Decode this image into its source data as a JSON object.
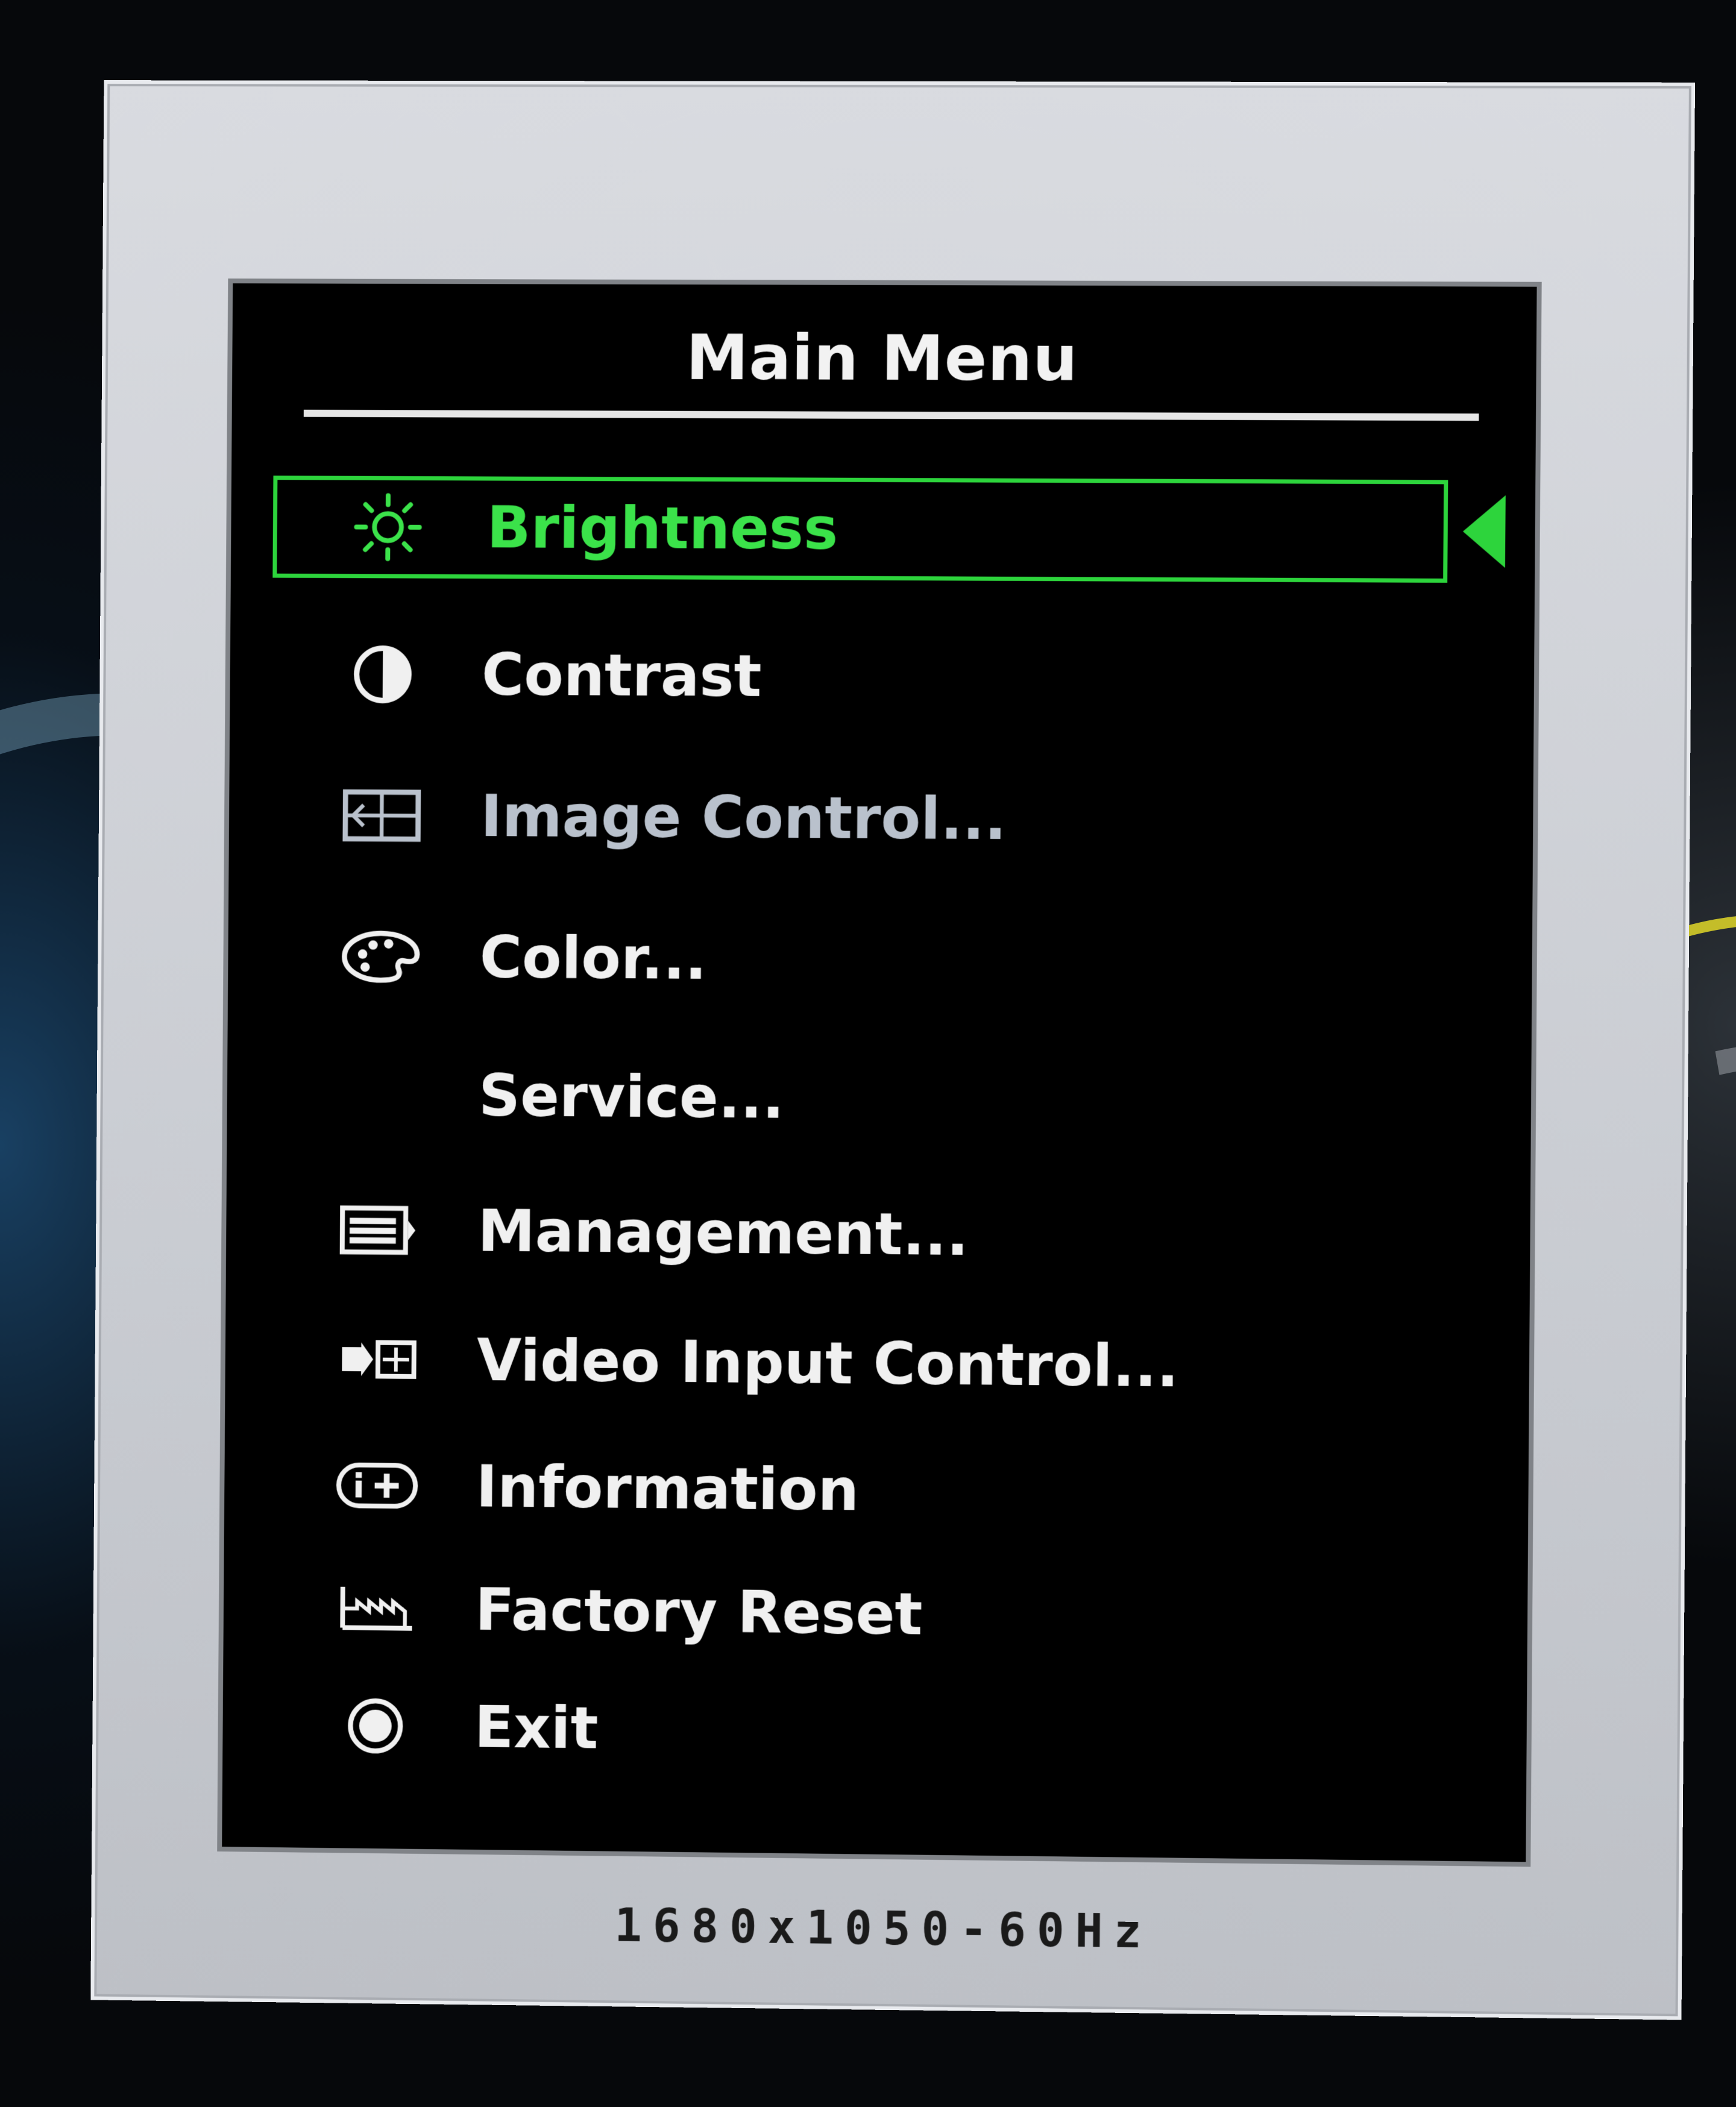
{
  "osd": {
    "title": "Main Menu",
    "items": [
      {
        "label": "Brightness",
        "icon": "sun-icon",
        "state": "selected"
      },
      {
        "label": "Contrast",
        "icon": "contrast-icon",
        "state": "normal"
      },
      {
        "label": "Image Control...",
        "icon": "image-control-icon",
        "state": "dimmed"
      },
      {
        "label": "Color...",
        "icon": "palette-icon",
        "state": "normal"
      },
      {
        "label": "Service...",
        "icon": "",
        "state": "normal"
      },
      {
        "label": "Management...",
        "icon": "management-icon",
        "state": "normal"
      },
      {
        "label": "Video Input Control...",
        "icon": "video-input-icon",
        "state": "normal"
      },
      {
        "label": "Information",
        "icon": "information-icon",
        "state": "normal"
      },
      {
        "label": "Factory Reset",
        "icon": "factory-icon",
        "state": "normal"
      },
      {
        "label": "Exit",
        "icon": "exit-icon",
        "state": "normal"
      }
    ],
    "resolution": "1680x1050-60Hz"
  },
  "colors": {
    "selection": "#2dd43c",
    "text": "#f0f0f0",
    "dim_text": "#b9c1cc",
    "panel": "#000000",
    "frame": "#d3d5da"
  }
}
